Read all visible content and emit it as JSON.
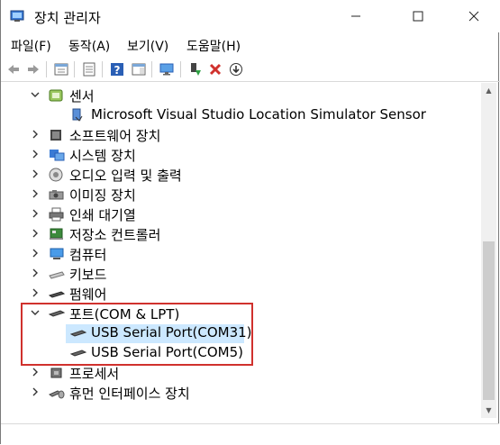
{
  "window": {
    "title": "장치 관리자"
  },
  "menu": [
    {
      "label": "파일(F)"
    },
    {
      "label": "동작(A)"
    },
    {
      "label": "보기(V)"
    },
    {
      "label": "도움말(H)"
    }
  ],
  "toolbar": {
    "icons": [
      "back-arrow-icon",
      "forward-arrow-icon",
      "properties-icon",
      "console-tree-icon",
      "help-icon",
      "action-pane-icon",
      "monitor-icon",
      "update-driver-icon",
      "uninstall-icon",
      "disable-icon"
    ]
  },
  "tree": {
    "sensors": {
      "label": "센서",
      "child": "Microsoft Visual Studio Location Simulator Sensor"
    },
    "software_devices": "소프트웨어 장치",
    "system_devices": "시스템 장치",
    "audio_io": "오디오 입력 및 출력",
    "imaging": "이미징 장치",
    "print_queues": "인쇄 대기열",
    "storage_controllers": "저장소 컨트롤러",
    "computer": "컴퓨터",
    "keyboards": "키보드",
    "firmware": "펌웨어",
    "ports": {
      "label": "포트(COM & LPT)",
      "children": [
        "USB Serial Port(COM31)",
        "USB Serial Port(COM5)"
      ]
    },
    "processors": "프로세서",
    "hid": "휴먼 인터페이스 장치"
  },
  "colors": {
    "selection": "#cce8ff",
    "highlight_border": "#d0312d",
    "accent": "#1e7bd8"
  }
}
